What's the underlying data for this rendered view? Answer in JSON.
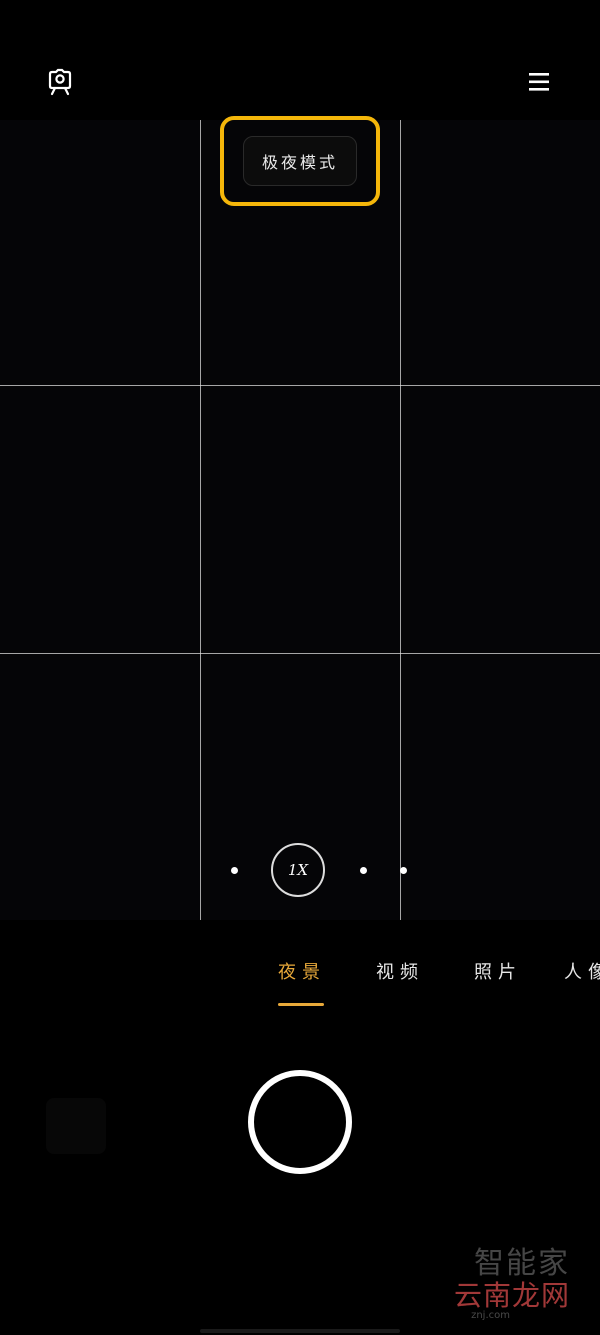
{
  "top_bar": {
    "left_icon": "camera-settings-icon",
    "right_icon": "menu-icon"
  },
  "viewfinder": {
    "mode_indicator": "极夜模式",
    "highlight_color": "#f5b70a",
    "zoom": {
      "label": "1X"
    }
  },
  "mode_tabs": {
    "items": [
      {
        "label": "夜景",
        "active": true
      },
      {
        "label": "视频",
        "active": false
      },
      {
        "label": "照片",
        "active": false
      },
      {
        "label": "人像",
        "active": false
      }
    ],
    "accent_color": "#e8a93a"
  },
  "watermark": {
    "line1": "智能家",
    "line2": "云南龙网",
    "url": "znj.com"
  }
}
